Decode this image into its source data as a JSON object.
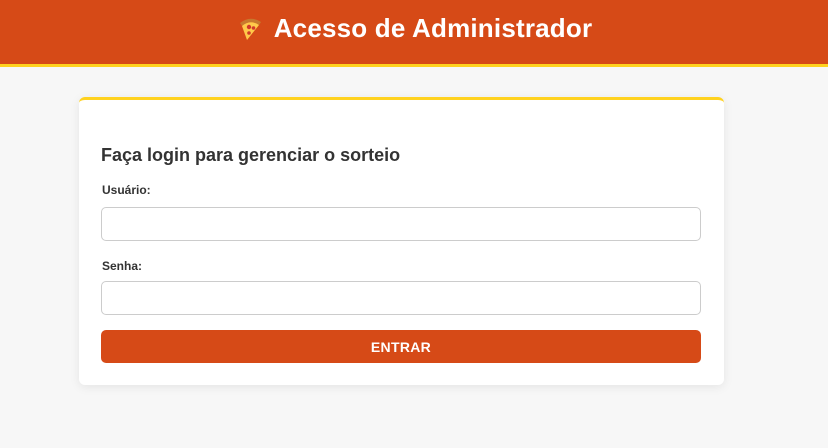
{
  "header": {
    "icon": "pizza-icon",
    "title": "Acesso de Administrador"
  },
  "login_card": {
    "heading": "Faça login para gerenciar o sorteio",
    "username": {
      "label": "Usuário:",
      "value": "",
      "placeholder": ""
    },
    "password": {
      "label": "Senha:",
      "value": "",
      "placeholder": ""
    },
    "submit_label": "ENTRAR"
  },
  "colors": {
    "brand": "#d64a17",
    "accent": "#ffd21f",
    "background": "#f7f7f7"
  }
}
